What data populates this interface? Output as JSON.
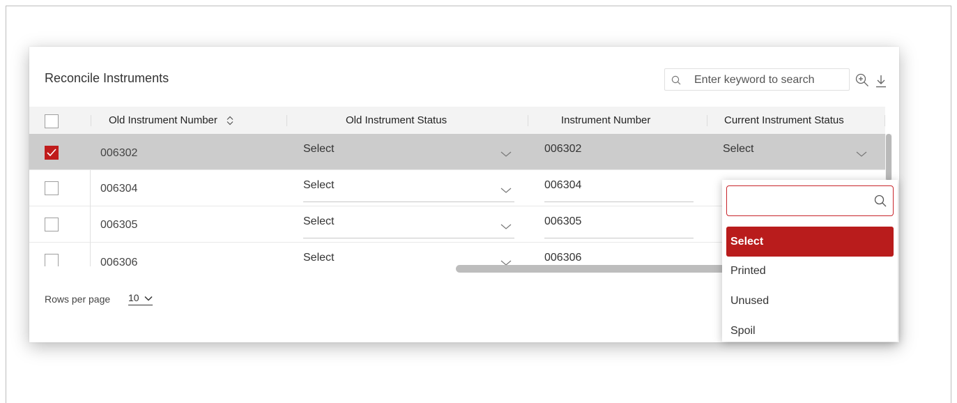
{
  "card": {
    "title": "Reconcile Instruments",
    "search_placeholder": "Enter keyword to search"
  },
  "table": {
    "columns": {
      "old_number": "Old Instrument Number",
      "old_status": "Old Instrument Status",
      "instrument_number": "Instrument Number",
      "current_status": "Current Instrument Status"
    },
    "rows": [
      {
        "old_number": "006302",
        "old_status": "Select",
        "instrument_number": "006302",
        "current_status": "Select",
        "checked": true
      },
      {
        "old_number": "006304",
        "old_status": "Select",
        "instrument_number": "006304",
        "checked": false
      },
      {
        "old_number": "006305",
        "old_status": "Select",
        "instrument_number": "006305",
        "checked": false
      },
      {
        "old_number": "006306",
        "old_status": "Select",
        "instrument_number": "006306",
        "checked": false
      }
    ]
  },
  "pagination": {
    "rows_per_page_label": "Rows per page",
    "rows_per_page_value": "10"
  },
  "dropdown": {
    "search_value": "",
    "options": [
      "Select",
      "Printed",
      "Unused",
      "Spoil"
    ],
    "active": "Select"
  },
  "colors": {
    "accent": "#b91c1c",
    "selected_row": "#cccccc",
    "header_bg": "#f3f3f3"
  },
  "icons": [
    "search-icon",
    "zoom-in-icon",
    "download-icon",
    "sort-icon",
    "chevron-down-icon",
    "checkmark-icon"
  ]
}
